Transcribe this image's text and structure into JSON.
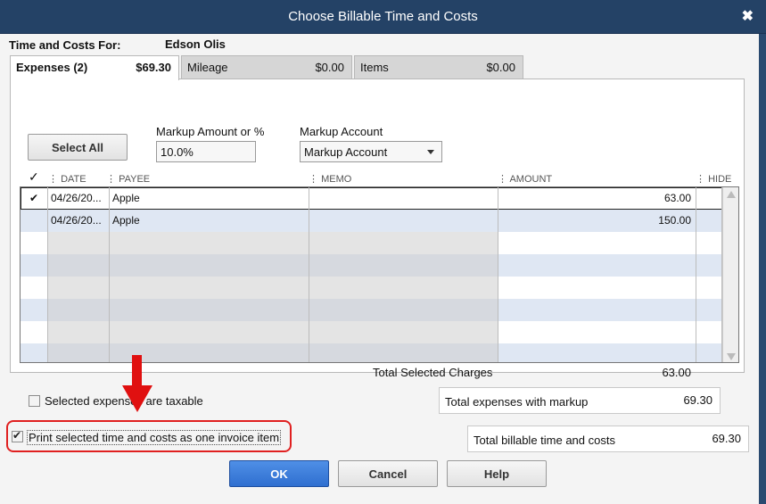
{
  "window": {
    "title": "Choose Billable Time and Costs",
    "close_glyph": "✖"
  },
  "header": {
    "for_label": "Time and Costs For:",
    "customer_name": "Edson Olis"
  },
  "tabs": [
    {
      "label": "Expenses (2)",
      "value": "$69.30",
      "active": true
    },
    {
      "label": "Mileage",
      "value": "$0.00",
      "active": false
    },
    {
      "label": "Items",
      "value": "$0.00",
      "active": false
    }
  ],
  "controls": {
    "select_all_label": "Select All",
    "markup_amount_label": "Markup Amount or %",
    "markup_amount_value": "10.0%",
    "markup_account_label": "Markup Account",
    "markup_account_value": "Markup Account"
  },
  "columns": {
    "check": "✓",
    "date": "DATE",
    "payee": "PAYEE",
    "memo": "MEMO",
    "amount": "AMOUNT",
    "hide": "HIDE"
  },
  "rows": [
    {
      "checked": "✔",
      "date": "04/26/20...",
      "payee": "Apple",
      "memo": "",
      "amount": "63.00"
    },
    {
      "checked": "",
      "date": "04/26/20...",
      "payee": "Apple",
      "memo": "",
      "amount": "150.00"
    }
  ],
  "totals": {
    "selected_charges_label": "Total Selected Charges",
    "selected_charges_value": "63.00",
    "expenses_markup_label": "Total expenses with markup",
    "expenses_markup_value": "69.30",
    "billable_label": "Total billable time and costs",
    "billable_value": "69.30"
  },
  "checkboxes": {
    "taxable_label": "Selected expenses are taxable",
    "taxable_checked": false,
    "print_one_item_label": "Print selected time and costs as one invoice item",
    "print_one_item_checked": true
  },
  "buttons": {
    "ok": "OK",
    "cancel": "Cancel",
    "help": "Help"
  },
  "colors": {
    "titlebar": "#244266",
    "highlight": "#e02020",
    "ok_button": "#2f6fd0"
  }
}
